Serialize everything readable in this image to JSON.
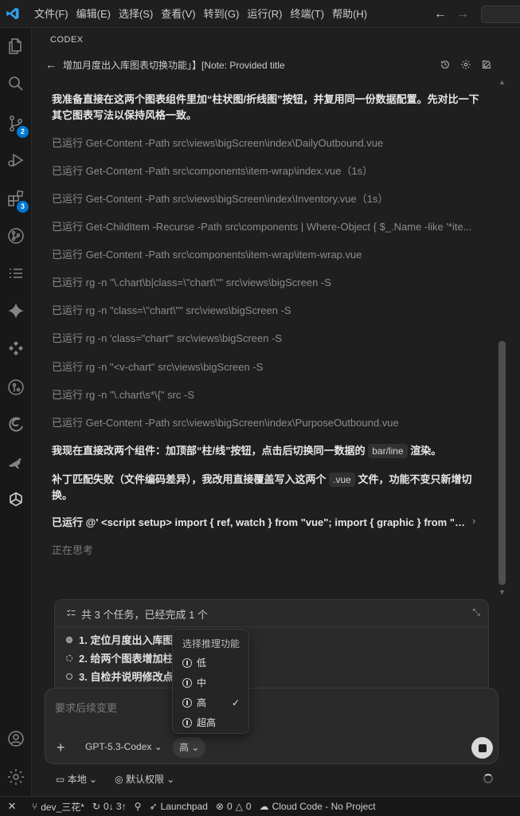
{
  "menu": [
    "文件(F)",
    "编辑(E)",
    "选择(S)",
    "查看(V)",
    "转到(G)",
    "运行(R)",
    "终端(T)",
    "帮助(H)"
  ],
  "activity": {
    "badges": {
      "source_control": "2",
      "extensions": "3"
    }
  },
  "panel": {
    "header": "CODEX",
    "title": "增加月度出入库图表切换功能」】[Note: Provided title"
  },
  "messages": [
    {
      "type": "text",
      "text": "我准备直接在这两个图表组件里加“柱状图/折线图”按钮，并复用同一份数据配置。先对比一下其它图表写法以保持风格一致。"
    },
    {
      "type": "run",
      "prefix": "已运行",
      "cmd": "Get-Content -Path src\\views\\bigScreen\\index\\DailyOutbound.vue"
    },
    {
      "type": "run",
      "prefix": "已运行",
      "cmd": "Get-Content -Path src\\components\\item-wrap\\index.vue（1s）"
    },
    {
      "type": "run",
      "prefix": "已运行",
      "cmd": "Get-Content -Path src\\views\\bigScreen\\index\\Inventory.vue（1s）"
    },
    {
      "type": "run",
      "prefix": "已运行",
      "cmd": "Get-ChildItem -Recurse -Path src\\components | Where-Object { $_.Name -like '*ite..."
    },
    {
      "type": "run",
      "prefix": "已运行",
      "cmd": "Get-Content -Path src\\components\\item-wrap\\item-wrap.vue"
    },
    {
      "type": "run",
      "prefix": "已运行",
      "cmd": "rg -n \"\\.chart\\b|class=\\\"chart\\\"\" src\\views\\bigScreen -S"
    },
    {
      "type": "run",
      "prefix": "已运行",
      "cmd": "rg -n \"class=\\\"chart\\\"\" src\\views\\bigScreen -S"
    },
    {
      "type": "run",
      "prefix": "已运行",
      "cmd": "rg -n 'class=\"chart\"' src\\views\\bigScreen -S"
    },
    {
      "type": "run",
      "prefix": "已运行",
      "cmd": "rg -n \"<v-chart\" src\\views\\bigScreen -S"
    },
    {
      "type": "run",
      "prefix": "已运行",
      "cmd": "rg -n \"\\.chart\\s*\\{\" src -S"
    },
    {
      "type": "run",
      "prefix": "已运行",
      "cmd": "Get-Content -Path src\\views\\bigScreen\\index\\PurposeOutbound.vue"
    },
    {
      "type": "rich1",
      "before": "我现在直接改两个组件：加顶部“柱/线”按钮，点击后切换同一数据的",
      "code": "bar/line",
      "after": "渲染。"
    },
    {
      "type": "rich2",
      "before": "补丁匹配失败（文件编码差异），我改用直接覆盖写入这两个",
      "code": ".vue",
      "after": "文件，功能不变只新增切换。"
    },
    {
      "type": "run2",
      "prefix": "已运行",
      "cmd": "@' <script setup> import { ref, watch } from \"vue\"; import { graphic } from \"echarts..."
    },
    {
      "type": "thinking",
      "text": "正在思考"
    }
  ],
  "tasks": {
    "summary": "共 3 个任务，已经完成 1 个",
    "items": [
      "1.  定位月度出入库图",
      "2.  给两个图表增加柱",
      "3.  自检并说明修改点"
    ]
  },
  "composer": {
    "placeholder": "要求后续变更",
    "model": "GPT-5.3-Codex",
    "effort": "高"
  },
  "dropdown": {
    "title": "选择推理功能",
    "options": [
      "低",
      "中",
      "高",
      "超高"
    ],
    "selected": "高"
  },
  "panel_footer": {
    "location": "本地",
    "permission": "默认权限"
  },
  "status": {
    "branch": "dev_三花*",
    "sync": "0↓ 3↑",
    "launchpad": "Launchpad",
    "errors": "0",
    "warnings": "0",
    "cloud": "Cloud Code - No Project"
  }
}
